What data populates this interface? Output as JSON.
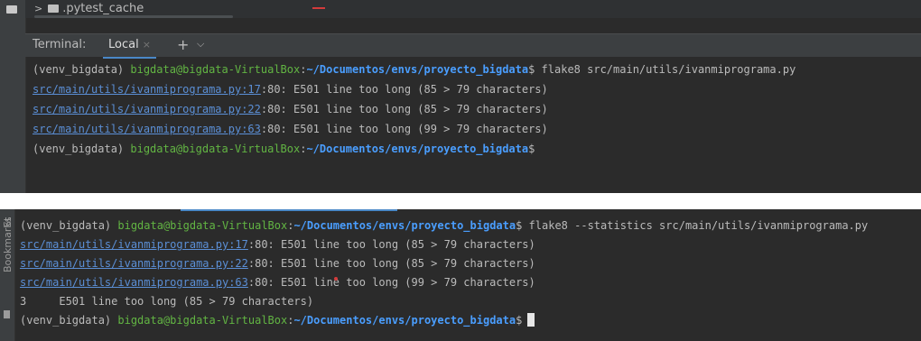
{
  "panel1": {
    "tree_item": ".pytest_cache",
    "terminal_label": "Terminal:",
    "tab_label": "Local",
    "close_glyph": "×",
    "plus_glyph": "+",
    "caret_glyph": "⌵",
    "lines": [
      {
        "venv": "(venv_bigdata) ",
        "userhost": "bigdata@bigdata-VirtualBox",
        "sep": ":",
        "path": "~/Documentos/envs/proyecto_bigdata",
        "dollar": "$ ",
        "cmd": "flake8 src/main/utils/ivanmiprograma.py"
      },
      {
        "link": "src/main/utils/ivanmiprograma.py:17",
        "rest": ":80: E501 line too long (85 > 79 characters)"
      },
      {
        "link": "src/main/utils/ivanmiprograma.py:22",
        "rest": ":80: E501 line too long (85 > 79 characters)"
      },
      {
        "link": "src/main/utils/ivanmiprograma.py:63",
        "rest": ":80: E501 line too long (99 > 79 characters)"
      },
      {
        "venv": "(venv_bigdata) ",
        "userhost": "bigdata@bigdata-VirtualBox",
        "sep": ":",
        "path": "~/Documentos/envs/proyecto_bigdata",
        "dollar": "$"
      }
    ]
  },
  "panel2": {
    "sidebar_labels": [
      "St",
      "Bookmarks"
    ],
    "lines": [
      {
        "venv": "(venv_bigdata) ",
        "userhost": "bigdata@bigdata-VirtualBox",
        "sep": ":",
        "path": "~/Documentos/envs/proyecto_bigdata",
        "dollar": "$ ",
        "cmd": "flake8 --statistics src/main/utils/ivanmiprograma.py"
      },
      {
        "link": "src/main/utils/ivanmiprograma.py:17",
        "rest": ":80: E501 line too long (85 > 79 characters)"
      },
      {
        "link": "src/main/utils/ivanmiprograma.py:22",
        "rest": ":80: E501 line too long (85 > 79 characters)"
      },
      {
        "link": "src/main/utils/ivanmiprograma.py:63",
        "rest": ":80: E501 line too long (99 > 79 characters)"
      },
      {
        "stat": "3     E501 line too long (85 > 79 characters)"
      },
      {
        "venv": "(venv_bigdata) ",
        "userhost": "bigdata@bigdata-VirtualBox",
        "sep": ":",
        "path": "~/Documentos/envs/proyecto_bigdata",
        "dollar": "$"
      }
    ]
  },
  "colors": {
    "background": "#2b2b2b",
    "userhost": "#62b543",
    "path": "#4a9eff",
    "link": "#5b8fd6",
    "text": "#bbbbbb"
  }
}
